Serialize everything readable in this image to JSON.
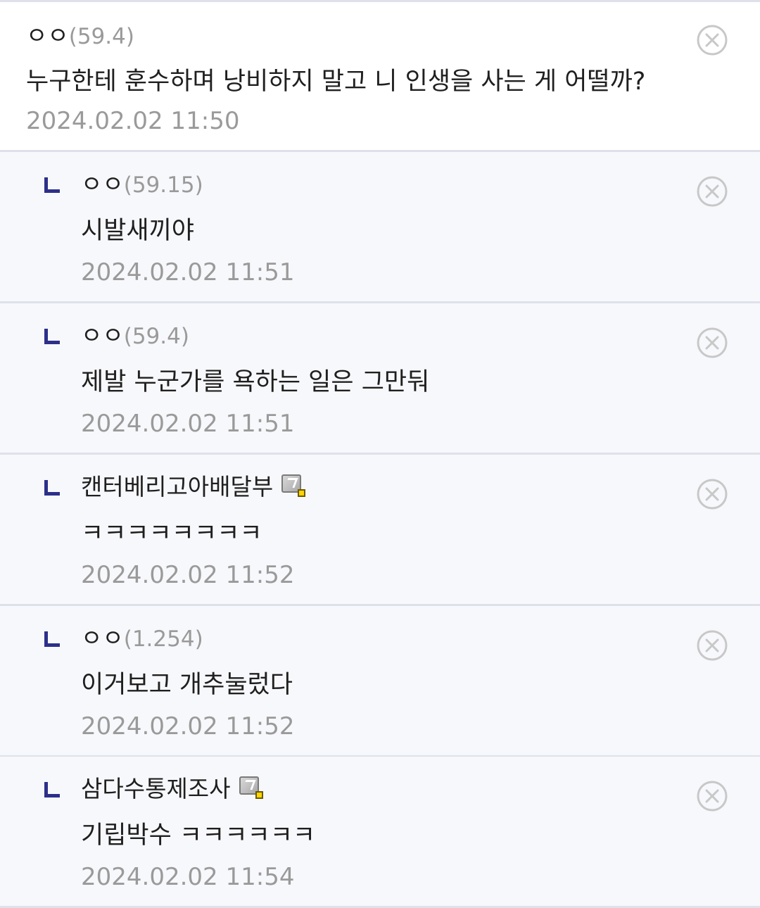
{
  "colors": {
    "reply_arrow": "#2c2f8a",
    "meta_gray": "#9a9a9a",
    "reply_background": "#f7f8fb",
    "divider": "#dfe1ea"
  },
  "delete_icon": "circle-x-icon",
  "gallery_icon": "gallery-member-icon",
  "comment": {
    "nick": "ㅇㅇ",
    "ip": "(59.4)",
    "text": "누구한테 훈수하며 낭비하지 말고 니 인생을 사는 게 어떨까?",
    "date": "2024.02.02 11:50"
  },
  "replies": [
    {
      "nick": "ㅇㅇ",
      "ip": "(59.15)",
      "text": "시발새끼야",
      "date": "2024.02.02 11:51"
    },
    {
      "nick": "ㅇㅇ",
      "ip": "(59.4)",
      "text": "제발 누군가를 욕하는 일은 그만둬",
      "date": "2024.02.02 11:51"
    },
    {
      "nick": "캔터베리고아배달부",
      "ip": "",
      "text": "ㅋㅋㅋㅋㅋㅋㅋㅋ",
      "date": "2024.02.02 11:52",
      "member_icon": true
    },
    {
      "nick": "ㅇㅇ",
      "ip": "(1.254)",
      "text": "이거보고 개추눌렀다",
      "date": "2024.02.02 11:52"
    },
    {
      "nick": "삼다수통제조사",
      "ip": "",
      "text": "기립박수 ㅋㅋㅋㅋㅋㅋ",
      "date": "2024.02.02 11:54",
      "member_icon": true
    }
  ]
}
